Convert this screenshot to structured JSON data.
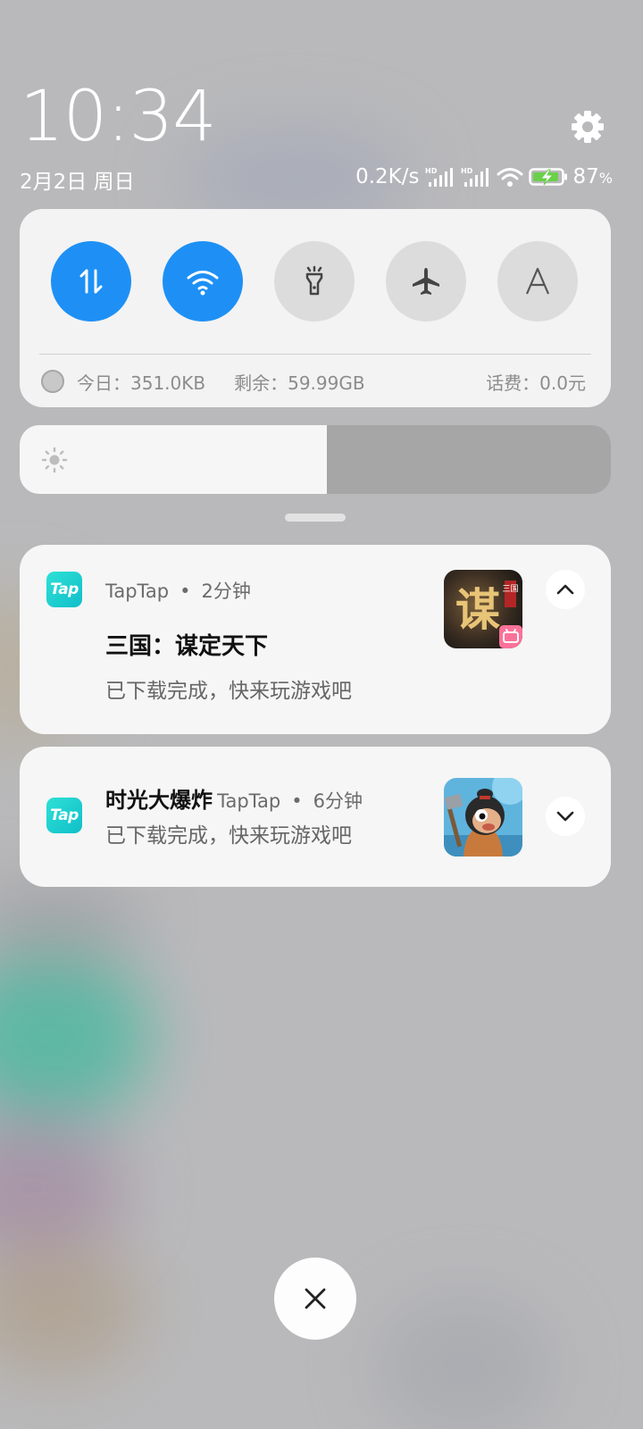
{
  "status_bar": {
    "time": "10:34",
    "date": "2月2日 周日",
    "network_speed": "0.2K/s",
    "battery": "87",
    "battery_unit": "%",
    "signal_badge_1": "HD",
    "signal_badge_2": "HD"
  },
  "quick_settings": {
    "toggles": [
      {
        "icon": "mobile-data-icon",
        "active": true
      },
      {
        "icon": "wifi-icon",
        "active": true
      },
      {
        "icon": "flashlight-icon",
        "active": false
      },
      {
        "icon": "airplane-mode-icon",
        "active": false
      },
      {
        "icon": "auto-brightness-icon",
        "active": false,
        "glyph": "A"
      }
    ],
    "usage_today": "今日：351.0KB",
    "usage_remaining": "剩余：59.99GB",
    "phone_fee": "话费：0.0元"
  },
  "brightness": {
    "level": 0.52
  },
  "notifications": [
    {
      "app": "TapTap",
      "app_icon_text": "Tap",
      "time": "2分钟",
      "title": "三国：谋定天下",
      "body": "已下载完成，快来玩游戏吧",
      "thumb_glyph": "谋",
      "thumb_badge": "三国",
      "expanded": true
    },
    {
      "app": "TapTap",
      "app_icon_text": "Tap",
      "time": "6分钟",
      "title": "时光大爆炸",
      "body": "已下载完成，快来玩游戏吧",
      "expanded": false
    }
  ],
  "separator": "•",
  "colors": {
    "accent": "#1e90f5",
    "tap_brand": "#15c8cf"
  }
}
